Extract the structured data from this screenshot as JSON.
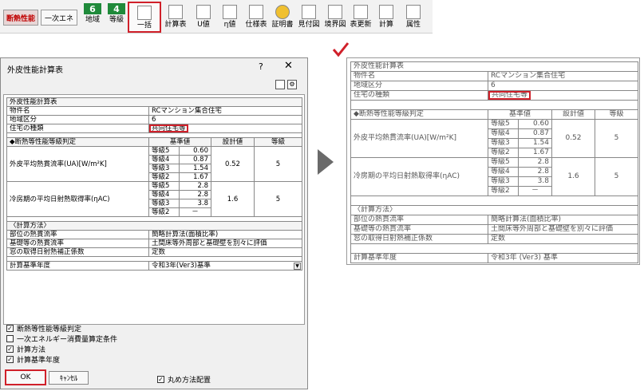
{
  "toolbar": {
    "insulation_tab": "断熱性能",
    "primary_energy_tab": "一次エネ",
    "region": {
      "number": "6",
      "label": "地域"
    },
    "grade": {
      "number": "4",
      "label": "等級"
    },
    "buttons": [
      "一括",
      "計算表",
      "U値",
      "η値",
      "仕様表",
      "証明書",
      "見付図",
      "境界図",
      "表更新",
      "計算",
      "属性"
    ]
  },
  "dialog": {
    "title": "外皮性能計算表",
    "help": "?",
    "close": "✕",
    "options": [
      {
        "label": "断熱等性能等級判定",
        "checked": true
      },
      {
        "label": "一次エネルギー消費量算定条件",
        "checked": false
      },
      {
        "label": "計算方法",
        "checked": true
      },
      {
        "label": "計算基準年度",
        "checked": true
      }
    ],
    "ok": "OK",
    "cancel": "ｷｬﾝｾﾙ",
    "maru_option": {
      "label": "丸め方法配置",
      "checked": true
    }
  },
  "sheet": {
    "title": "外皮性能計算表",
    "property_label": "物件名",
    "property_value": "RCマンション集合住宅",
    "region_label": "地域区分",
    "region_value": "6",
    "housing_label": "住宅の種類",
    "housing_value": "共同住宅等",
    "judge_header": "◆断熱等性能等級判定",
    "col_standard": "基準値",
    "col_design": "設計値",
    "col_grade": "等級",
    "ua": {
      "label": "外皮平均熱貫流率(UA)[W/m²K]",
      "rows": [
        {
          "grade": "等級5",
          "value": "0.60"
        },
        {
          "grade": "等級4",
          "value": "0.87"
        },
        {
          "grade": "等級3",
          "value": "1.54"
        },
        {
          "grade": "等級2",
          "value": "1.67"
        }
      ],
      "design": "0.52",
      "result": "5"
    },
    "eta": {
      "label": "冷房期の平均日射熱取得率(ηAC)",
      "rows": [
        {
          "grade": "等級5",
          "value": "2.8"
        },
        {
          "grade": "等級4",
          "value": "2.8"
        },
        {
          "grade": "等級3",
          "value": "3.8"
        },
        {
          "grade": "等級2",
          "value": "－"
        }
      ],
      "design": "1.6",
      "result": "5"
    },
    "method_header": "〈計算方法〉",
    "method_rows": [
      {
        "label": "部位の熱貫流率",
        "value": "簡略計算法(面積比率)"
      },
      {
        "label": "基礎等の熱貫流率",
        "value": "土間床等外周部と基礎壁を別々に評価"
      },
      {
        "label": "窓の取得日射熱補正係数",
        "value": "定数"
      }
    ],
    "year_label": "計算基準年度",
    "year_value": "令和3年(Ver3)基準"
  },
  "preview": {
    "method_rows": [
      {
        "label": "部位の熱貫流率",
        "value": "簡略計算法(面積比率)"
      },
      {
        "label": "基礎等の熱貫流率",
        "value": "土間床等外周部と基礎壁を別々に評価"
      },
      {
        "label": "窓の取得日射熱補正係数",
        "value": "定数"
      }
    ],
    "year_value": "令和3年 (Ver3) 基準"
  },
  "colors": {
    "highlight": "#d0202a",
    "badge_green": "#1f8a3a"
  }
}
